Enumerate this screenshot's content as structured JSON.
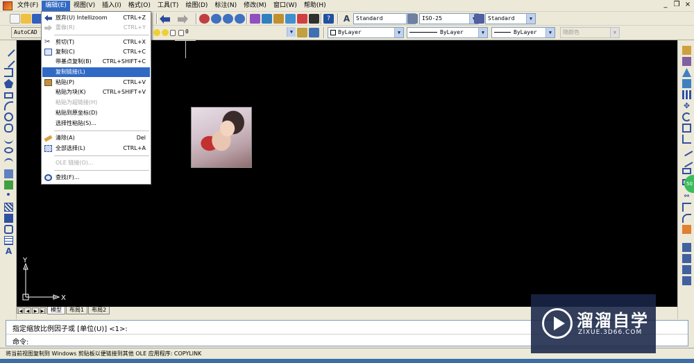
{
  "menubar": {
    "items": [
      "文件(F)",
      "编辑(E)",
      "视图(V)",
      "插入(I)",
      "格式(O)",
      "工具(T)",
      "绘图(D)",
      "标注(N)",
      "修改(M)",
      "窗口(W)",
      "帮助(H)"
    ],
    "active_index": 1
  },
  "toolbar2": {
    "workspace": "AutoCAD 经",
    "layer": "0",
    "color": "ByLayer",
    "linetype": "ByLayer",
    "lineweight": "ByLayer",
    "plotstyle": "随颜色"
  },
  "toolbar1": {
    "text_style": "Standard",
    "dim_style": "ISO-25",
    "table_style": "Standard"
  },
  "edit_menu": {
    "items": [
      {
        "label": "放弃(U) Intellizoom",
        "shortcut": "CTRL+Z",
        "disabled": false,
        "icon": "undo-icon"
      },
      {
        "label": "重做(R)",
        "shortcut": "CTRL+Y",
        "disabled": true,
        "icon": "redo-icon"
      },
      {
        "label": "剪切(T)",
        "shortcut": "CTRL+X",
        "disabled": false,
        "icon": "scissors-icon"
      },
      {
        "label": "复制(C)",
        "shortcut": "CTRL+C",
        "disabled": false,
        "icon": "copy-icon"
      },
      {
        "label": "带基点复制(B)",
        "shortcut": "CTRL+SHIFT+C",
        "disabled": false,
        "icon": ""
      },
      {
        "label": "复制链接(L)",
        "shortcut": "",
        "disabled": false,
        "icon": "",
        "highlighted": true
      },
      {
        "label": "粘贴(P)",
        "shortcut": "CTRL+V",
        "disabled": false,
        "icon": "paste-icon"
      },
      {
        "label": "粘贴为块(K)",
        "shortcut": "CTRL+SHIFT+V",
        "disabled": false,
        "icon": ""
      },
      {
        "label": "粘贴为超链接(H)",
        "shortcut": "",
        "disabled": true,
        "icon": ""
      },
      {
        "label": "粘贴到原坐标(D)",
        "shortcut": "",
        "disabled": false,
        "icon": ""
      },
      {
        "label": "选择性粘贴(S)...",
        "shortcut": "",
        "disabled": false,
        "icon": ""
      },
      {
        "label": "清除(A)",
        "shortcut": "Del",
        "disabled": false,
        "icon": "eraser-icon"
      },
      {
        "label": "全部选择(L)",
        "shortcut": "CTRL+A",
        "disabled": false,
        "icon": "select-all-icon"
      },
      {
        "label": "OLE 链接(O)...",
        "shortcut": "",
        "disabled": true,
        "icon": ""
      },
      {
        "label": "查找(F)...",
        "shortcut": "",
        "disabled": false,
        "icon": "find-icon"
      }
    ]
  },
  "layout_tabs": [
    "模型",
    "布局1",
    "布局2"
  ],
  "ucs": {
    "x_label": "X",
    "y_label": "Y"
  },
  "command": {
    "line1": "指定缩放比例因子或 [单位(U)] <1>:",
    "line2": "命令:"
  },
  "status": "将当前视图复制到 Windows 剪贴板以便链接到其他 OLE 应用程序:   COPYLINK",
  "watermark": {
    "title": "溜溜自学",
    "subtitle": "ZIXUE.3D66.COM"
  },
  "side_badge": "50",
  "colors": {
    "menu_highlight": "#316ac5",
    "canvas": "#000000",
    "chrome": "#ece9d8"
  }
}
